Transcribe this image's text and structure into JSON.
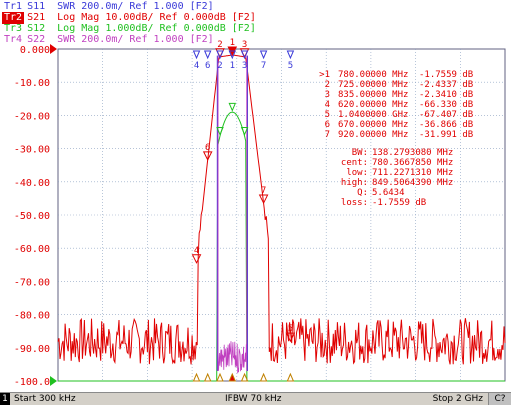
{
  "trace_labels": [
    {
      "tag": "Tr1",
      "text": "S11  SWR 200.0m/ Ref 1.000 [F2]",
      "color": "#3a3ad8",
      "active": false
    },
    {
      "tag": "Tr2",
      "text": "S21  Log Mag 10.00dB/ Ref 0.000dB [F2]",
      "color": "#e00000",
      "active": true
    },
    {
      "tag": "Tr3",
      "text": "S12  Log Mag 1.000dB/ Ref 0.000dB [F2]",
      "color": "#20c020",
      "active": false
    },
    {
      "tag": "Tr4",
      "text": "S22  SWR 200.0m/ Ref 1.000 [F2]",
      "color": "#c040c0",
      "active": false
    }
  ],
  "y_ticks": [
    "0.000",
    "-10.00",
    "-20.00",
    "-30.00",
    "-40.00",
    "-50.00",
    "-60.00",
    "-70.00",
    "-80.00",
    "-90.00",
    "-100.0"
  ],
  "marker_table": [
    {
      "id": ">1",
      "freq": "780.00000 MHz",
      "val": "-1.7559 dB"
    },
    {
      "id": "2",
      "freq": "725.00000 MHz",
      "val": "-2.4337 dB"
    },
    {
      "id": "3",
      "freq": "835.00000 MHz",
      "val": "-2.3410 dB"
    },
    {
      "id": "4",
      "freq": "620.00000 MHz",
      "val": "-66.330 dB"
    },
    {
      "id": "5",
      "freq": "1.0400000 GHz",
      "val": "-67.407 dB"
    },
    {
      "id": "6",
      "freq": "670.00000 MHz",
      "val": "-36.866 dB"
    },
    {
      "id": "7",
      "freq": "920.00000 MHz",
      "val": "-31.991 dB"
    }
  ],
  "bw_stats": [
    {
      "label": "BW:",
      "value": "138.2793080 MHz"
    },
    {
      "label": "cent:",
      "value": "780.3667850 MHz"
    },
    {
      "label": "low:",
      "value": "711.2271310 MHz"
    },
    {
      "label": "high:",
      "value": "849.5064390 MHz"
    },
    {
      "label": "Q:",
      "value": "5.6434"
    },
    {
      "label": "loss:",
      "value": "-1.7559 dB"
    }
  ],
  "top_markers": [
    "4",
    "6",
    "2",
    "1",
    "3",
    "7",
    "5"
  ],
  "status": {
    "channel": "1",
    "start": "Start 300 kHz",
    "ifbw": "IFBW 70 kHz",
    "stop": "Stop 2 GHz",
    "mode": "C?"
  },
  "colors": {
    "s11": "#3a3ad8",
    "s21": "#e00000",
    "s12": "#20c020",
    "s22": "#c040c0",
    "grid": "#8aa0c0",
    "plot_bg": "#ffffff"
  },
  "chart_data": {
    "type": "line",
    "x_start_mhz": 0.3,
    "x_stop_mhz": 2000,
    "ylim": [
      -100,
      0
    ],
    "series": [
      {
        "name": "S21",
        "color": "#e00000"
      },
      {
        "name": "S12",
        "color": "#20c020"
      },
      {
        "name": "S11",
        "color": "#3a3ad8"
      },
      {
        "name": "S22",
        "color": "#c040c0"
      }
    ]
  }
}
